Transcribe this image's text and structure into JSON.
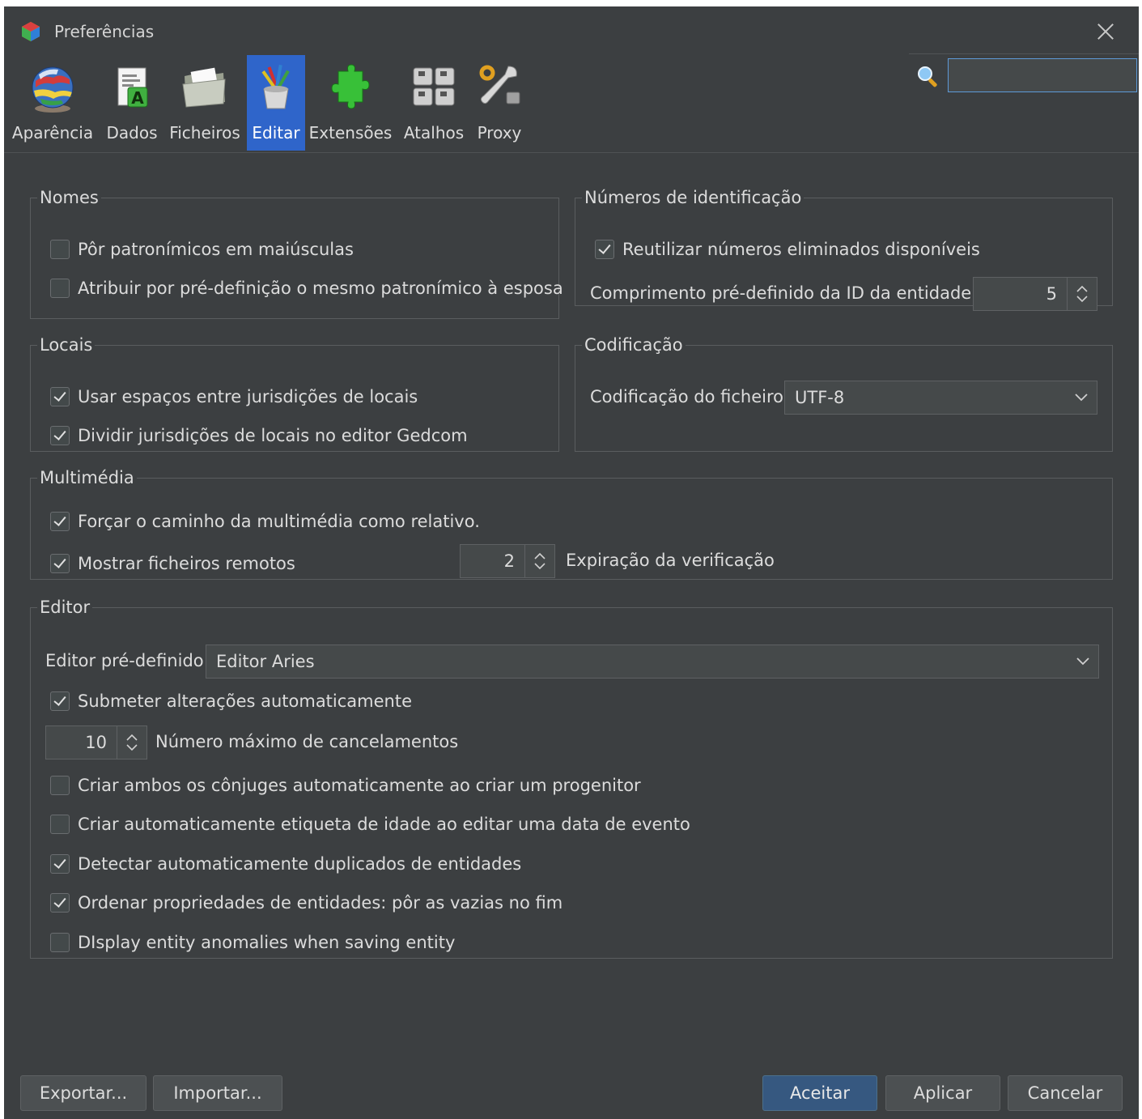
{
  "window": {
    "title": "Preferências"
  },
  "tabs": [
    {
      "label": "Aparência",
      "icon": "globe-icon"
    },
    {
      "label": "Dados",
      "icon": "document-icon"
    },
    {
      "label": "Ficheiros",
      "icon": "folder-icon"
    },
    {
      "label": "Editar",
      "icon": "brushes-icon",
      "active": true
    },
    {
      "label": "Extensões",
      "icon": "puzzle-icon"
    },
    {
      "label": "Atalhos",
      "icon": "keys-icon"
    },
    {
      "label": "Proxy",
      "icon": "tools-icon"
    }
  ],
  "search": {
    "value": ""
  },
  "nomes": {
    "title": "Nomes",
    "opt1": {
      "label": "Pôr patronímicos em maiúsculas",
      "checked": false
    },
    "opt2": {
      "label": "Atribuir por pré-definição o mesmo patronímico à esposa",
      "checked": false
    }
  },
  "ids": {
    "title": "Números de identificação",
    "opt1": {
      "label": "Reutilizar números eliminados disponíveis",
      "checked": true
    },
    "length_label": "Comprimento pré-definido da ID da entidade:",
    "length_value": "5"
  },
  "locais": {
    "title": "Locais",
    "opt1": {
      "label": "Usar espaços entre jurisdições de locais",
      "checked": true
    },
    "opt2": {
      "label": "Dividir jurisdições de locais no editor Gedcom",
      "checked": true
    }
  },
  "codificacao": {
    "title": "Codificação",
    "label": "Codificação do ficheiro",
    "value": "UTF-8"
  },
  "multimedia": {
    "title": "Multimédia",
    "opt1": {
      "label": "Forçar o caminho da multimédia como relativo.",
      "checked": true
    },
    "opt2": {
      "label": "Mostrar ficheiros remotos",
      "checked": true
    },
    "expiry_value": "2",
    "expiry_label": "Expiração da verificação"
  },
  "editor": {
    "title": "Editor",
    "default_label": "Editor pré-definido",
    "default_value": "Editor Aries",
    "opt_submit": {
      "label": "Submeter alterações automaticamente",
      "checked": true
    },
    "undo_value": "10",
    "undo_label": "Número máximo de cancelamentos",
    "opt_spouses": {
      "label": "Criar ambos os cônjuges automaticamente ao criar um progenitor",
      "checked": false
    },
    "opt_age": {
      "label": "Criar automaticamente etiqueta de idade ao editar uma data de evento",
      "checked": false
    },
    "opt_dup": {
      "label": "Detectar automaticamente duplicados de entidades",
      "checked": true
    },
    "opt_sort": {
      "label": "Ordenar propriedades de entidades: pôr as vazias no fim",
      "checked": true
    },
    "opt_anom": {
      "label": "DIsplay entity anomalies when saving entity",
      "checked": false
    }
  },
  "buttons": {
    "export": "Exportar...",
    "import": "Importar...",
    "accept": "Aceitar",
    "apply": "Aplicar",
    "cancel": "Cancelar"
  }
}
